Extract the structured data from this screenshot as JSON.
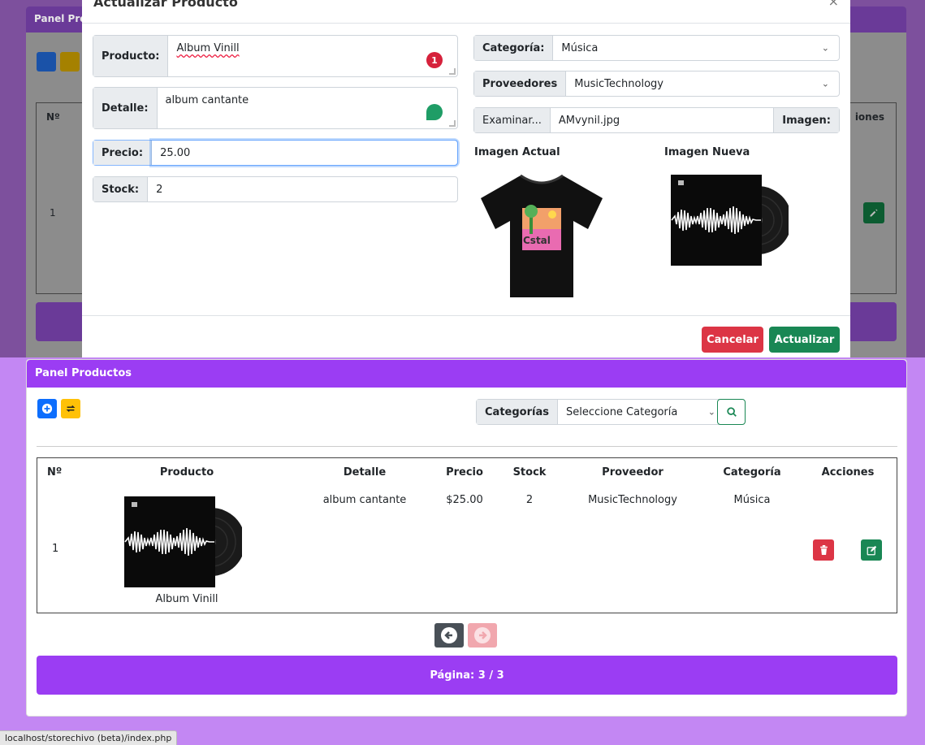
{
  "modal": {
    "title": "Actualizar Producto",
    "close_glyph": "×",
    "fields": {
      "producto": {
        "label": "Producto:",
        "value": "Album Vinill",
        "badge": "1"
      },
      "detalle": {
        "label": "Detalle:",
        "value": "album cantante"
      },
      "precio": {
        "label": "Precio:",
        "value": "25.00"
      },
      "stock": {
        "label": "Stock:",
        "value": "2"
      },
      "categoria": {
        "label": "Categoría:",
        "value": "Música"
      },
      "proveedores": {
        "label": "Proveedores",
        "value": "MusicTechnology"
      },
      "imagen": {
        "browse_label": "Examinar...",
        "file_name": "AMvynil.jpg",
        "label": "Imagen:"
      }
    },
    "imagen_actual_label": "Imagen Actual",
    "imagen_nueva_label": "Imagen Nueva",
    "cancel_label": "Cancelar",
    "update_label": "Actualizar"
  },
  "background": {
    "panel_title": "Panel Pro",
    "col_n": "Nº",
    "col_acciones": "iones",
    "row_num": "1"
  },
  "panel": {
    "title": "Panel Productos",
    "categorias_label": "Categorías",
    "categorias_placeholder": "Seleccione Categoría",
    "columns": {
      "n": "Nº",
      "producto": "Producto",
      "detalle": "Detalle",
      "precio": "Precio",
      "stock": "Stock",
      "proveedor": "Proveedor",
      "categoria": "Categoría",
      "acciones": "Acciones"
    },
    "rows": [
      {
        "n": "1",
        "producto": "Album Vinill",
        "detalle": "album cantante",
        "precio": "$25.00",
        "stock": "2",
        "proveedor": "MusicTechnology",
        "categoria": "Música"
      }
    ],
    "pagination": "Página: 3 / 3"
  },
  "status_bar": "localhost/storechivo (beta)/index.php",
  "colors": {
    "purple": "#9b3df3",
    "danger": "#dc3545",
    "success": "#198754",
    "primary": "#0d6efd",
    "warning": "#ffc107"
  },
  "icons": {
    "add": "plus-circle-icon",
    "refresh": "refresh-arrows-icon",
    "search": "search-icon",
    "delete": "trash-icon",
    "edit": "edit-icon",
    "prev": "arrow-left-circle-icon",
    "next": "arrow-right-circle-icon"
  }
}
